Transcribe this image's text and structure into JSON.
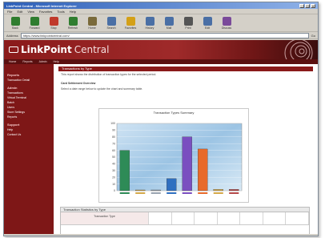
{
  "window": {
    "title": "LinkPoint Central - Microsoft Internet Explorer"
  },
  "menu": [
    "File",
    "Edit",
    "View",
    "Favorites",
    "Tools",
    "Help"
  ],
  "toolbar": [
    {
      "label": "Back",
      "icon": "back-arrow-icon",
      "color": "#2f7d2f"
    },
    {
      "label": "Forward",
      "icon": "forward-arrow-icon",
      "color": "#2f7d2f"
    },
    {
      "label": "Stop",
      "icon": "stop-icon",
      "color": "#c0392b"
    },
    {
      "label": "Refresh",
      "icon": "refresh-icon",
      "color": "#2f7d2f"
    },
    {
      "label": "Home",
      "icon": "home-icon",
      "color": "#7a6a3a"
    },
    {
      "label": "Search",
      "icon": "search-icon",
      "color": "#4a6fa5"
    },
    {
      "label": "Favorites",
      "icon": "favorites-icon",
      "color": "#d4a017"
    },
    {
      "label": "History",
      "icon": "history-icon",
      "color": "#4a6fa5"
    },
    {
      "label": "Mail",
      "icon": "mail-icon",
      "color": "#4a6fa5"
    },
    {
      "label": "Print",
      "icon": "print-icon",
      "color": "#555555"
    },
    {
      "label": "Edit",
      "icon": "edit-icon",
      "color": "#4a6fa5"
    },
    {
      "label": "Discuss",
      "icon": "discuss-icon",
      "color": "#7a4a9a"
    }
  ],
  "address": {
    "label": "Address",
    "url": "https://www.linkpointcentral.com/",
    "go": "Go"
  },
  "banner": {
    "logo_bold": "LinkPoint",
    "logo_light": "Central"
  },
  "nav": [
    "Home",
    "Reports",
    "Admin",
    "Help"
  ],
  "sidebar": {
    "section1": "Reports",
    "items1": [
      "Transaction Detail"
    ],
    "section2": "Admin",
    "items2": [
      "Transactions",
      "Virtual Terminal",
      "Batch",
      "Users",
      "Store Settings",
      "Reports"
    ],
    "section3": "Support",
    "items3": [
      "Help",
      "Contact Us"
    ]
  },
  "main": {
    "header": "Transactions by Type",
    "text1": "This report shows the distribution of transaction types for the selected period.",
    "text2": "Card Settlement Overview",
    "text3": "Select a date range below to update the chart and summary table."
  },
  "chart_data": {
    "type": "bar",
    "title": "Transaction Types Summary",
    "categories": [
      "1",
      "2",
      "3",
      "4",
      "5",
      "6",
      "7",
      "8"
    ],
    "values": [
      60,
      0,
      0,
      18,
      80,
      62,
      2,
      2
    ],
    "colors": [
      "#2e8b57",
      "#d4a94a",
      "#9aa5b1",
      "#2f6fc0",
      "#7a4fc0",
      "#e86a2a",
      "#d4a94a",
      "#b54a4a"
    ],
    "ylim": [
      0,
      100
    ],
    "grid": true
  },
  "table": {
    "title": "Transaction Statistics by Type",
    "columns": [
      "Transaction Type",
      "",
      "",
      "",
      "",
      "",
      "",
      ""
    ]
  }
}
